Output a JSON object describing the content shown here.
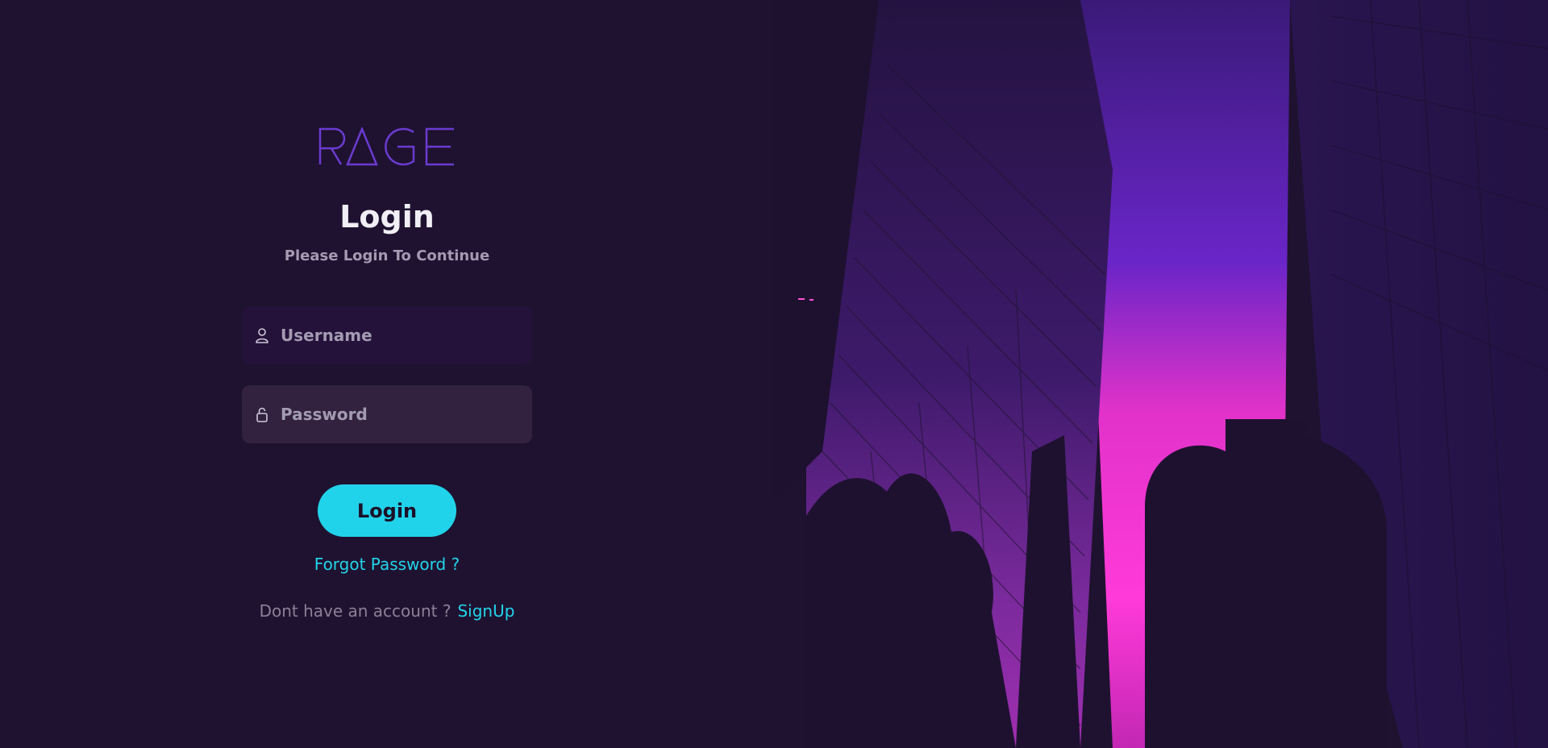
{
  "brand": {
    "logo_text": "RAGE",
    "logo_color": "#6a3bd1"
  },
  "login": {
    "title": "Login",
    "subtitle": "Please Login To Continue",
    "username_placeholder": "Username",
    "password_placeholder": "Password",
    "button_label": "Login",
    "forgot_label": "Forgot Password ?",
    "signup_prompt": "Dont have an account ?",
    "signup_label": "SignUp"
  },
  "colors": {
    "background": "#1f1230",
    "accent": "#21d3ea",
    "field_active": "#25123a",
    "field_idle": "#32223f"
  },
  "hero_image": {
    "icon": "city-skyline-neon-image"
  }
}
